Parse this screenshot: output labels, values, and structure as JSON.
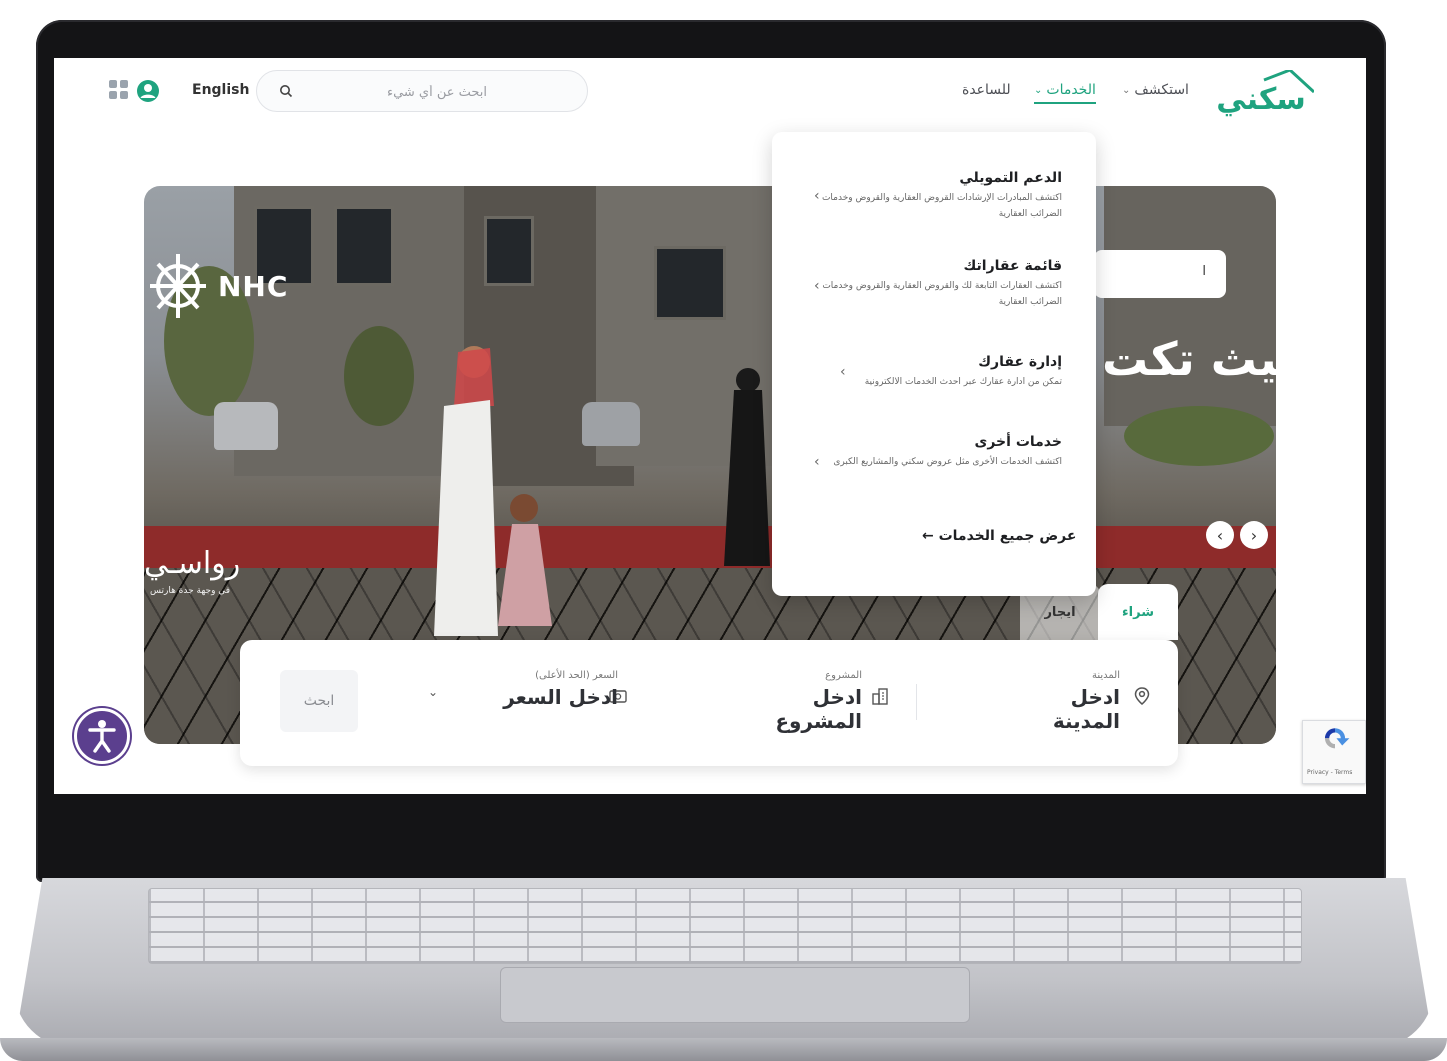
{
  "header": {
    "logo_text": "سكني",
    "nav": [
      {
        "label": "استكشف"
      },
      {
        "label": "الخدمات"
      },
      {
        "label": "للساعدة"
      }
    ],
    "search_placeholder": "ابحث عن أي شيء",
    "language": "English"
  },
  "hero": {
    "brand": "NHC",
    "project_name": "رواسـي",
    "project_subtitle": "في وجهة جدة هارتس",
    "headline": "حيث تكت",
    "cta": "ا",
    "slider_prev": "‹",
    "slider_next": "›"
  },
  "services_menu": {
    "items": [
      {
        "title": "الدعم التمويلي",
        "description": "اكتشف المبادرات الإرشادات القروض العقارية والقروض وخدمات الضرائب العقارية"
      },
      {
        "title": "قائمة عقاراتك",
        "description": "اكتشف العقارات التابعة لك والقروض العقارية والقروض وخدمات الضرائب العقارية"
      },
      {
        "title": "إدارة عقارك",
        "description": "تمكن من ادارة عقارك عبر احدث الخدمات الالكترونية"
      },
      {
        "title": "خدمات أخرى",
        "description": "اكتشف الخدمات الأخرى مثل عروض سكني والمشاريع الكبرى"
      }
    ],
    "view_all": "عرض جميع الخدمات ←"
  },
  "search_tabs": [
    {
      "label": "شراء",
      "active": true
    },
    {
      "label": "ايجار",
      "active": false
    }
  ],
  "search_panel": {
    "city_label": "المدينة",
    "city_value": "ادخل المدينة",
    "project_label": "المشروع",
    "project_value": "ادخل المشروع",
    "price_label": "السعر (الحد الأعلى)",
    "price_value": "ادخل السعر",
    "submit": "ابحث"
  },
  "recaptcha": {
    "footer": "Privacy - Terms"
  },
  "colors": {
    "brand": "#1fa37f",
    "accessibility": "#5b3f8e"
  }
}
